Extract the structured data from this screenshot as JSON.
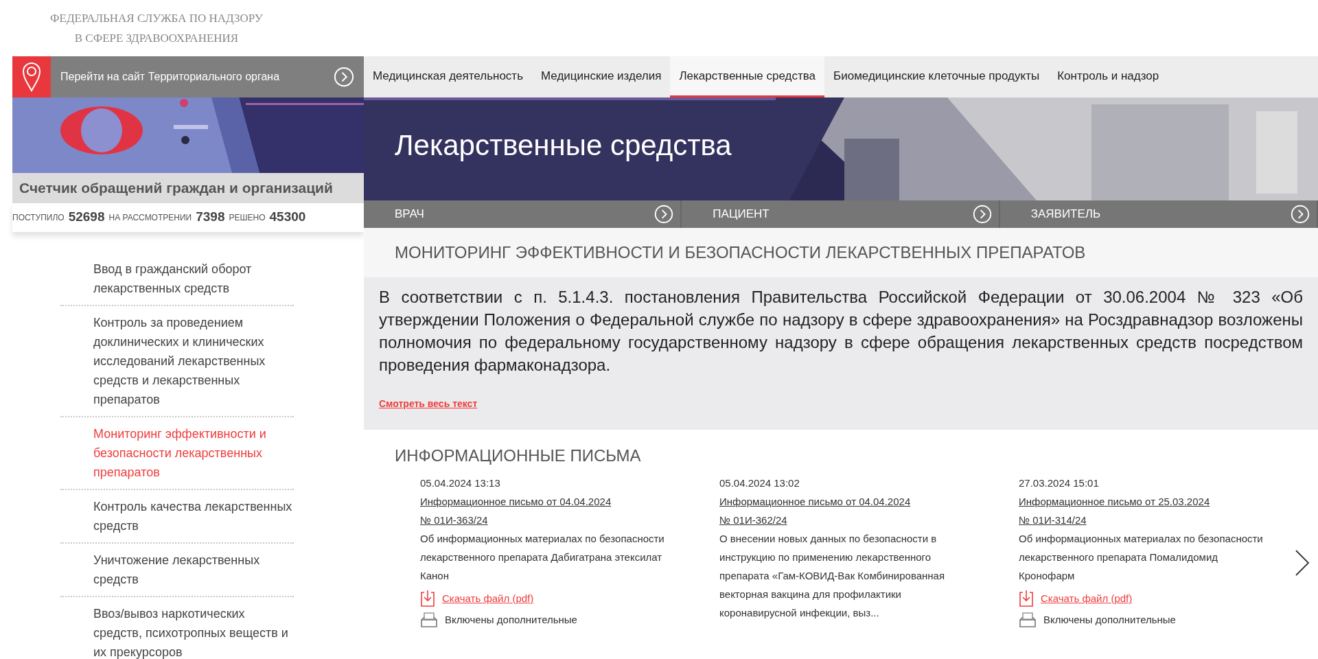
{
  "agency_name_lines": [
    "ФЕДЕРАЛЬНАЯ СЛУЖБА ПО НАДЗОРУ",
    "В СФЕРЕ ЗДРАВООХРАНЕНИЯ"
  ],
  "territorial_link": {
    "label": "Перейти на сайт Территориального органа"
  },
  "banner_left": {
    "kind": "picture"
  },
  "counter": {
    "title": "Счетчик обращений граждан и организаций",
    "stats": [
      {
        "label": "ПОСТУПИЛО",
        "value": "52698"
      },
      {
        "label": "НА РАССМОТРЕНИИ",
        "value": "7398"
      },
      {
        "label": "РЕШЕНО",
        "value": "45300"
      }
    ]
  },
  "sidebar": {
    "items": [
      {
        "label": "Ввод в гражданский оборот лекарственных средств",
        "selected": false
      },
      {
        "label": "Контроль за проведением доклинических и клинических исследований лекарственных средств и лекарственных препаратов",
        "selected": false
      },
      {
        "label": "Мониторинг эффективности и безопасности лекарственных препаратов",
        "selected": true
      },
      {
        "label": "Контроль качества лекарственных средств",
        "selected": false
      },
      {
        "label": "Уничтожение лекарственных средств",
        "selected": false
      },
      {
        "label": "Ввоз/вывоз наркотических средств, психотропных веществ и их прекурсоров",
        "selected": false
      }
    ]
  },
  "main_nav": {
    "tabs": [
      {
        "label": "Медицинская деятельность",
        "selected": false
      },
      {
        "label": "Медицинские изделия",
        "selected": false
      },
      {
        "label": "Лекарственные средства",
        "selected": true
      },
      {
        "label": "Биомедицинские клеточные продукты",
        "selected": false
      },
      {
        "label": "Контроль и надзор",
        "selected": false
      }
    ]
  },
  "banner": {
    "title": "Лекарственные средства",
    "audiences": [
      {
        "label": "ВРАЧ"
      },
      {
        "label": "ПАЦИЕНТ"
      },
      {
        "label": "ЗАЯВИТЕЛЬ"
      }
    ]
  },
  "section": {
    "heading": "МОНИТОРИНГ ЭФФЕКТИВНОСТИ И БЕЗОПАСНОСТИ ЛЕКАРСТВЕННЫХ ПРЕПАРАТОВ",
    "text": "В соответствии с п. 5.1.4.3. постановления Правительства Российской Федерации от 30.06.2004 № 323 «Об утверждении Положения о Федеральной службе по надзору в сфере здравоохранения» на Росздравнадзор возложены полномочия по федеральному государственному надзору в сфере обращения лекарственных средств посредством проведения фармаконадзора.",
    "more_link": "Смотреть весь текст"
  },
  "letters": {
    "heading": "ИНФОРМАЦИОННЫЕ ПИСЬМА",
    "items": [
      {
        "date": "05.04.2024 13:13",
        "title": "Информационное письмо от 04.04.2024 № 01И-363/24",
        "description": "Об информационных материалах по безопасности лекарственного препарата Дабигатрана этексилат Канон",
        "download": "Скачать файл (pdf)",
        "extra": "Включены дополнительные"
      },
      {
        "date": "05.04.2024 13:02",
        "title": "Информационное письмо от 04.04.2024 № 01И-362/24",
        "description": "О внесении новых данных по безопасности в инструкцию по применению лекарственного препарата «Гам-КОВИД-Вак Комбинированная векторная вакцина для профилактики коронавирусной инфекции, выз..."
      },
      {
        "date": "27.03.2024 15:01",
        "title": "Информационное письмо от 25.03.2024 № 01И-314/24",
        "description": "Об информационных материалах по безопасности лекарственного препарата Помалидомид Кронофарм",
        "download": "Скачать файл (pdf)",
        "extra": "Включены дополнительные"
      }
    ]
  }
}
